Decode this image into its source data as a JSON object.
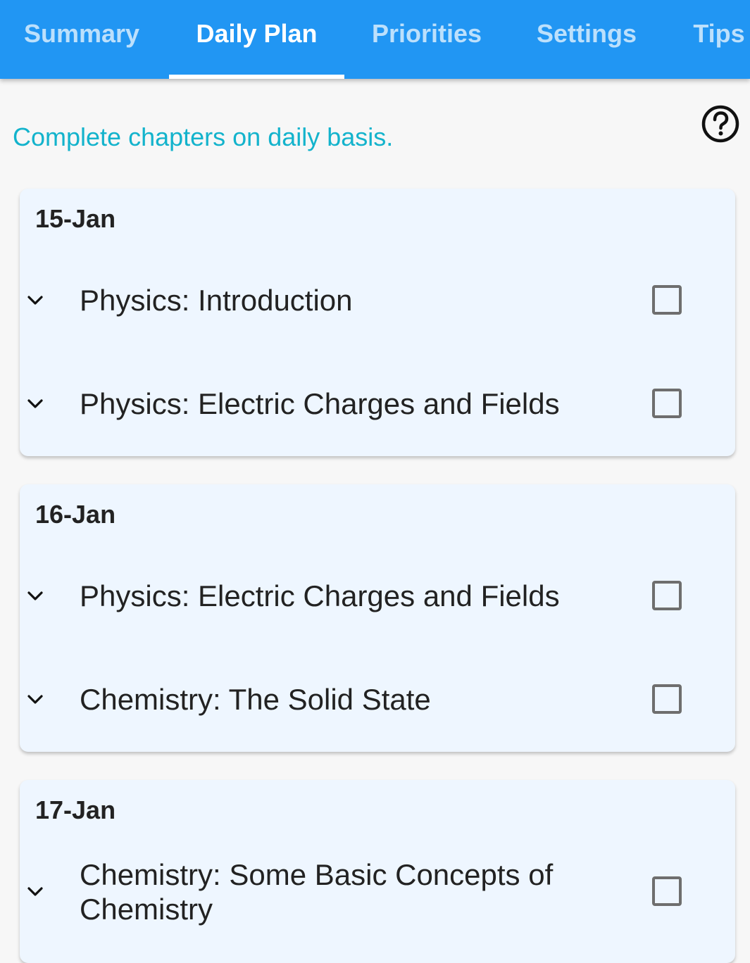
{
  "tabs": [
    {
      "label": "Summary",
      "active": false
    },
    {
      "label": "Daily Plan",
      "active": true
    },
    {
      "label": "Priorities",
      "active": false
    },
    {
      "label": "Settings",
      "active": false
    },
    {
      "label": "Tips",
      "active": false
    }
  ],
  "intro_text": "Complete chapters on daily basis.",
  "icons": {
    "help": "help-circle-icon",
    "expand": "chevron-down-icon"
  },
  "colors": {
    "tabbar": "#2196f3",
    "intro_text": "#13b3cc",
    "card_bg": "#eef6ff"
  },
  "days": [
    {
      "date": "15-Jan",
      "items": [
        {
          "label": "Physics: Introduction",
          "checked": false
        },
        {
          "label": "Physics: Electric Charges and Fields",
          "checked": false
        }
      ]
    },
    {
      "date": "16-Jan",
      "items": [
        {
          "label": "Physics: Electric Charges and Fields",
          "checked": false
        },
        {
          "label": "Chemistry: The Solid State",
          "checked": false
        }
      ]
    },
    {
      "date": "17-Jan",
      "items": [
        {
          "label": "Chemistry: Some Basic Concepts of Chemistry",
          "checked": false
        }
      ]
    }
  ]
}
